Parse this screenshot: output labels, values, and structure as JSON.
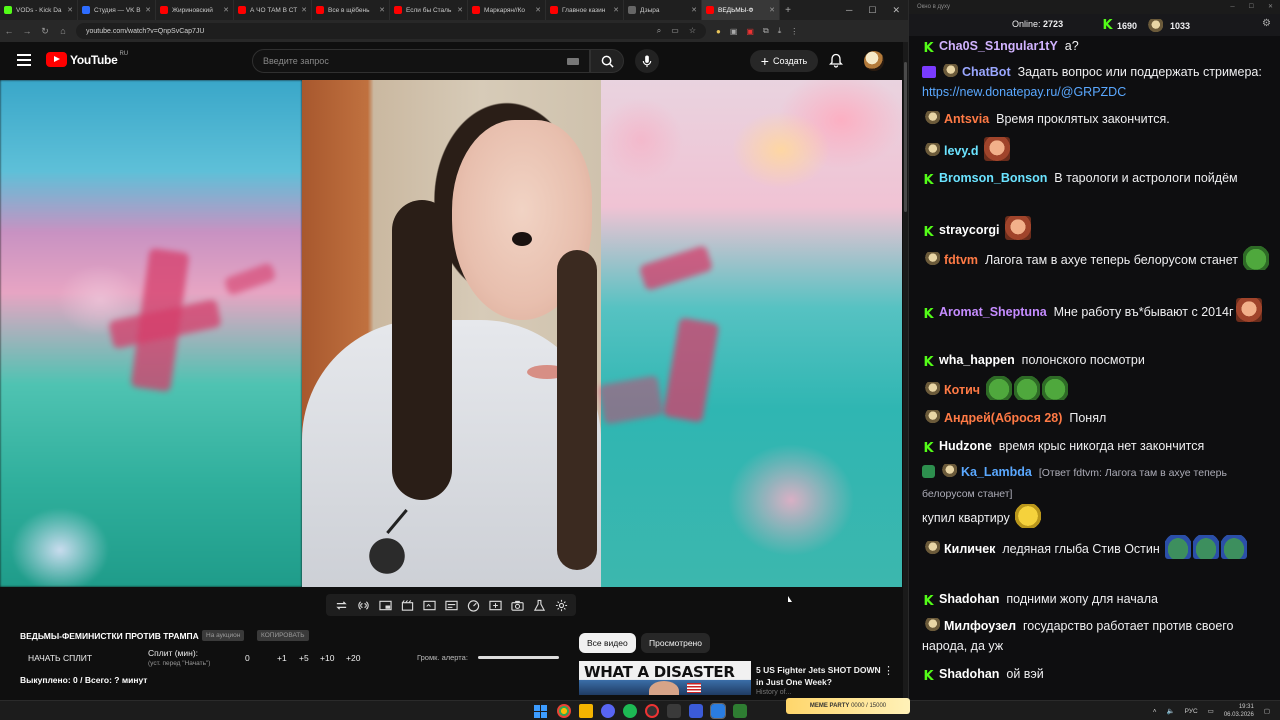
{
  "browser": {
    "tabs": [
      {
        "label": "VODs - Kick Da",
        "color": "#53fc18"
      },
      {
        "label": "Студия — VK В",
        "color": "#2d6cff"
      },
      {
        "label": "Жириновский",
        "color": "#ff0000"
      },
      {
        "label": "А ЧО ТАМ В СТ",
        "color": "#ff0000"
      },
      {
        "label": "Все в щёбень",
        "color": "#ff0000"
      },
      {
        "label": "Если бы Сталь",
        "color": "#ff0000"
      },
      {
        "label": "Маркарян//Ко",
        "color": "#ff0000"
      },
      {
        "label": "Главное казин",
        "color": "#ff0000"
      },
      {
        "label": "Дзыра",
        "color": "#666666"
      },
      {
        "label": "ВЕДЬМЫ-Ф",
        "color": "#ff0000"
      }
    ],
    "close_glyph": "✕",
    "new_tab": "+",
    "url": "youtube.com/watch?v=QnpSvCap7JU"
  },
  "youtube": {
    "logo_text": "YouTube",
    "region": "RU",
    "search_placeholder": "Введите запрос",
    "create_label": "Создать"
  },
  "panel": {
    "video_title": "ВЕДЬМЫ-ФЕМИНИСТКИ ПРОТИВ ТРАМПА",
    "chip1": "На аукцион",
    "chip2": "КОПИРОВАТЬ",
    "start_split": "НАЧАТЬ СПЛИТ",
    "split_label": "Сплит (мин):",
    "split_sub": "(уст. перед \"Начать\")",
    "split_values": [
      "0",
      "+1",
      "+5",
      "+10",
      "+20"
    ],
    "volume_label": "Громк. алерта:",
    "bought": "Выкуплено: 0 / Всего: ? минут",
    "volume_level": 0.95
  },
  "recommendations": {
    "filter_all": "Все видео",
    "filter_watched": "Просмотрено",
    "thumb_text": "WHAT A DISASTER",
    "title": "5 US Fighter Jets SHOT DOWN in Just One Week?",
    "meta": "History of..."
  },
  "chat": {
    "window_title": "Окно в духу",
    "online_label": "Online:",
    "online_count": "2723",
    "kick_count": "1690",
    "twitch_count": "1033",
    "messages": [
      {
        "user": "Cha0S_S1ngular1tY",
        "color": "#d1b3ff",
        "badge": "kick",
        "text": "а?"
      },
      {
        "user": "ChatBot",
        "color": "#9aa7ff",
        "badge": "bot",
        "text": "Задать вопрос или поддержать стримера: ",
        "link": "https://new.donatepay.ru/@GRPZDC"
      },
      {
        "user": "Antsvia",
        "color": "#ff7a45",
        "badge": "av",
        "text": "Время проклятых закончится."
      },
      {
        "user": "levy.d",
        "color": "#6be3ff",
        "badge": "av",
        "text": ""
      },
      {
        "user": "Bromson_Bonson",
        "color": "#6be3ff",
        "badge": "kick",
        "text": "В тарологи и астрологи пойдём"
      },
      {
        "user": "straycorgi",
        "color": "#ffffff",
        "badge": "kick",
        "text": ""
      },
      {
        "user": "fdtvm",
        "color": "#ff7a45",
        "badge": "av",
        "text": "Лагога там в ахуе теперь белорусом станет"
      },
      {
        "user": "Aromat_Sheptuna",
        "color": "#c58cff",
        "badge": "kick",
        "text": "Мне работу въ*бывают с 2014г"
      },
      {
        "user": "wha_happen",
        "color": "#ffffff",
        "badge": "kick",
        "text": "полонского посмотри"
      },
      {
        "user": "Котич",
        "color": "#ff7a45",
        "badge": "av",
        "text": ""
      },
      {
        "user": "Андрей(Аброся 28)",
        "color": "#ff7a45",
        "badge": "av",
        "text": "Понял"
      },
      {
        "user": "Hudzone",
        "color": "#ffffff",
        "badge": "kick",
        "text": "время крыс никогда нет закончится"
      },
      {
        "user": "Ka_Lambda",
        "color": "#5aa8ff",
        "badge": "av",
        "reply": "[Ответ fdtvm: Лагога там в ахуе теперь белорусом станет]",
        "text": "купил квартиру"
      },
      {
        "user": "Киличек",
        "color": "#ffffff",
        "badge": "av",
        "text": "ледяная глыба Стив Остин"
      },
      {
        "user": "Shadohan",
        "color": "#ffffff",
        "badge": "kick",
        "text": "подними жопу для начала"
      },
      {
        "user": "Милфоузел",
        "color": "#ffffff",
        "badge": "av",
        "text": "государство работает против своего народа, да уж"
      },
      {
        "user": "Shadohan",
        "color": "#ffffff",
        "badge": "kick",
        "text": "ой вэй"
      }
    ]
  },
  "taskbar": {
    "meme_label": "MEME PARTY",
    "meme_sub": "0000 / 15000",
    "lang": "РУС",
    "time": "19:31",
    "date": "06.03.2026"
  }
}
